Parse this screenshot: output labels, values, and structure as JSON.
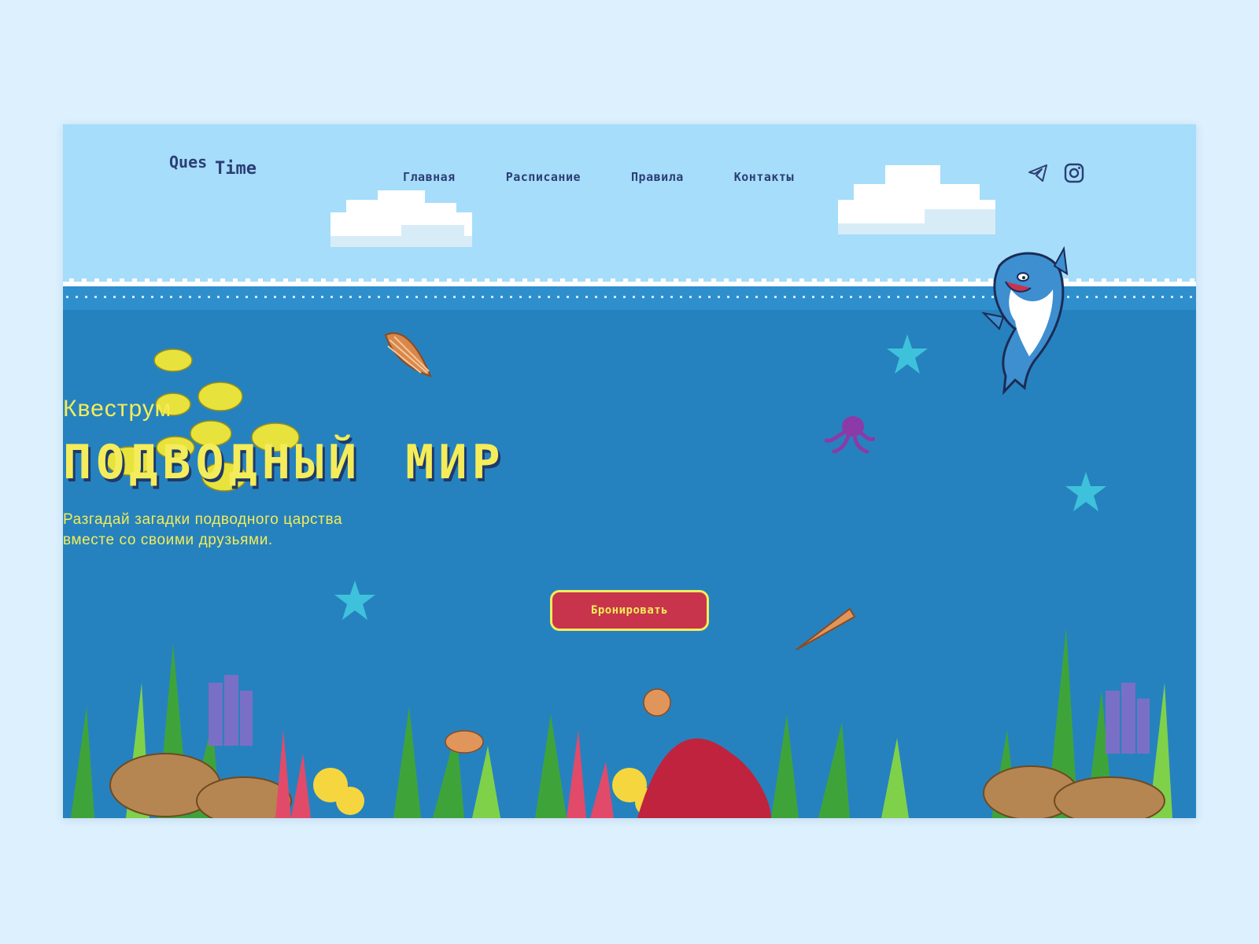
{
  "logo": {
    "part1": "Ques",
    "part2": "Time"
  },
  "nav": {
    "items": [
      {
        "label": "Главная"
      },
      {
        "label": "Расписание"
      },
      {
        "label": "Правила"
      },
      {
        "label": "Контакты"
      }
    ]
  },
  "social": {
    "icons": [
      "telegram-icon",
      "instagram-icon"
    ]
  },
  "hero": {
    "kicker": "Квеструм",
    "title": "ПОДВОДНЫЙ МИР",
    "subtitle_line1": "Разгадай загадки подводного царства",
    "subtitle_line2": "вместе со своими друзьями.",
    "cta_label": "Бронировать"
  },
  "colors": {
    "page_bg": "#dcf0fe",
    "sky": "#a6ddfa",
    "sea": "#2682be",
    "accent_yellow": "#f4ec5a",
    "button_red": "#c8344c",
    "nav_text": "#2c3e75"
  }
}
